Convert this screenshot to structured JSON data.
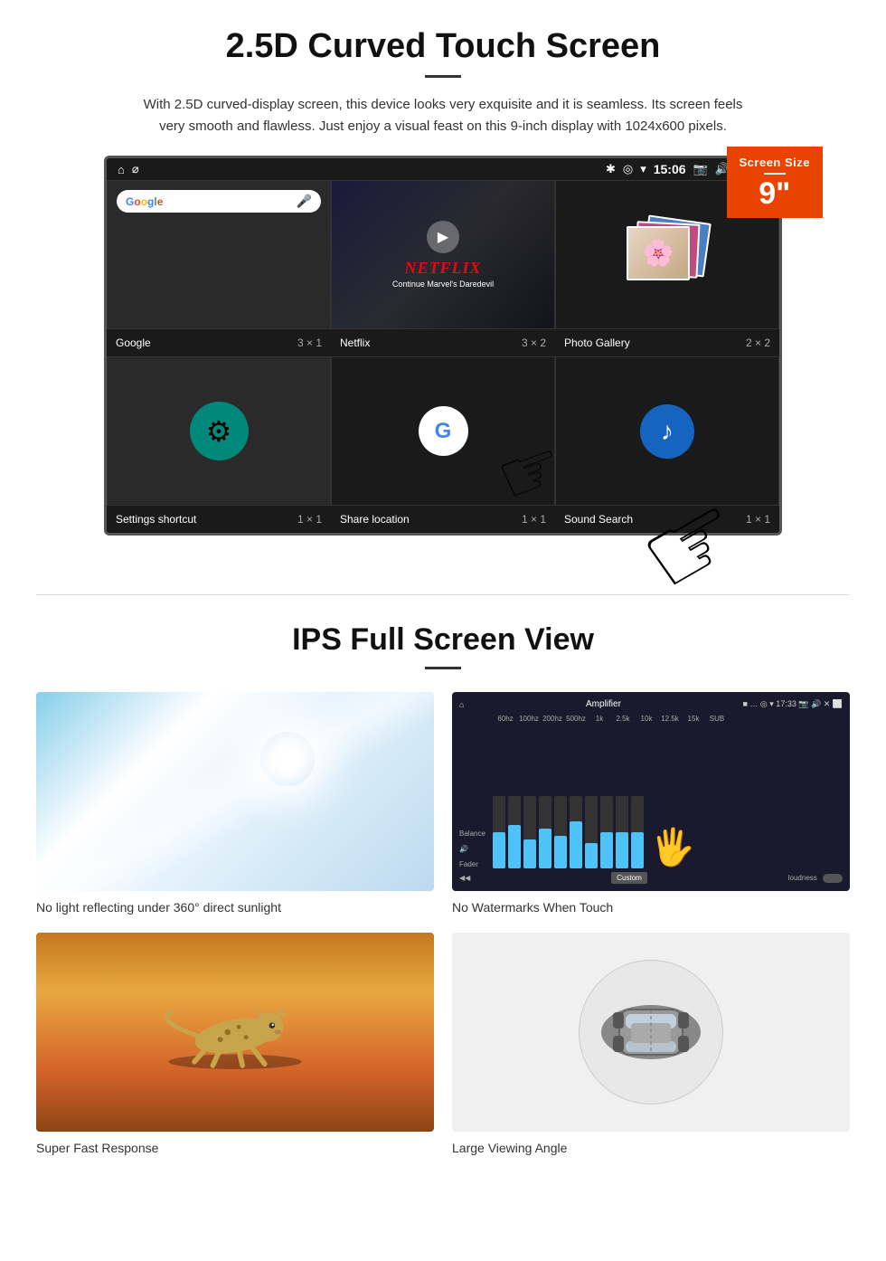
{
  "section1": {
    "title": "2.5D Curved Touch Screen",
    "description": "With 2.5D curved-display screen, this device looks very exquisite and it is seamless. Its screen feels very smooth and flawless. Just enjoy a visual feast on this 9-inch display with 1024x600 pixels.",
    "screen_badge": {
      "label": "Screen Size",
      "size": "9\""
    },
    "device": {
      "status_bar": {
        "usb_icon": "⌀",
        "time": "15:06",
        "icons": [
          "📷",
          "🔊",
          "✕",
          "⬜"
        ]
      },
      "apps": [
        {
          "name": "Google",
          "size": "3 × 1",
          "type": "google"
        },
        {
          "name": "Netflix",
          "size": "3 × 2",
          "type": "netflix",
          "netflix_text": "NETFLIX",
          "netflix_sub": "Continue Marvel's Daredevil"
        },
        {
          "name": "Photo Gallery",
          "size": "2 × 2",
          "type": "gallery"
        },
        {
          "name": "Settings shortcut",
          "size": "1 × 1",
          "type": "settings"
        },
        {
          "name": "Share location",
          "size": "1 × 1",
          "type": "share"
        },
        {
          "name": "Sound Search",
          "size": "1 × 1",
          "type": "sound"
        }
      ]
    }
  },
  "section2": {
    "title": "IPS Full Screen View",
    "features": [
      {
        "label": "No light reflecting under 360° direct sunlight",
        "type": "sunlight"
      },
      {
        "label": "No Watermarks When Touch",
        "type": "amplifier"
      },
      {
        "label": "Super Fast Response",
        "type": "cheetah"
      },
      {
        "label": "Large Viewing Angle",
        "type": "car"
      }
    ]
  }
}
